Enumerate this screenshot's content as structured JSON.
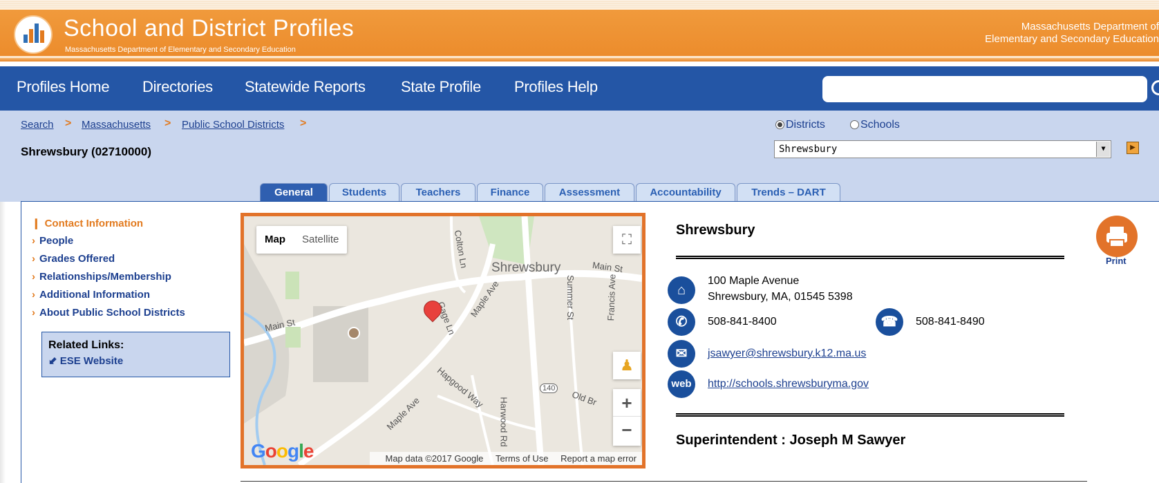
{
  "header": {
    "title": "School and District Profiles",
    "subtitle": "Massachusetts Department of Elementary and Secondary Education",
    "org_line1": "Massachusetts Department of",
    "org_line2": "Elementary and Secondary Education"
  },
  "nav": {
    "items": [
      "Profiles Home",
      "Directories",
      "Statewide Reports",
      "State Profile",
      "Profiles Help"
    ],
    "search_value": ""
  },
  "breadcrumb": {
    "items": [
      "Search",
      "Massachusetts",
      "Public School Districts"
    ],
    "separator": ">"
  },
  "entity_title": "Shrewsbury (02710000)",
  "selector": {
    "options": [
      "Districts",
      "Schools"
    ],
    "selected_option": "Districts",
    "select_value": "Shrewsbury"
  },
  "tabs": [
    "General",
    "Students",
    "Teachers",
    "Finance",
    "Assessment",
    "Accountability",
    "Trends – DART"
  ],
  "active_tab": "General",
  "sidebar": {
    "links": [
      "Contact Information",
      "People",
      "Grades Offered",
      "Relationships/Membership",
      "Additional Information",
      "About Public School Districts"
    ],
    "current": "Contact Information",
    "related_title": "Related Links:",
    "related_link": "ESE Website"
  },
  "map": {
    "toggle": [
      "Map",
      "Satellite"
    ],
    "selected": "Map",
    "place_label": "Shrewsbury",
    "street_labels": [
      "Main St",
      "Main St",
      "Maple Ave",
      "Maple Ave",
      "Gage Ln",
      "Colton Ln",
      "Hapgood Way",
      "Summer St",
      "Francis Ave",
      "Old Br",
      "Harwood Rd",
      "140"
    ],
    "attribution": [
      "Map data ©2017 Google",
      "Terms of Use",
      "Report a map error"
    ],
    "logo": "Google"
  },
  "contact": {
    "name": "Shrewsbury",
    "address_line1": "100 Maple Avenue",
    "address_line2": "Shrewsbury, MA, 01545 5398",
    "phone": "508-841-8400",
    "fax": "508-841-8490",
    "email": "jsawyer@shrewsbury.k12.ma.us",
    "website": "http://schools.shrewsburyma.gov",
    "superintendent": "Superintendent : Joseph M Sawyer",
    "web_icon_text": "web",
    "print_label": "Print"
  },
  "colors": {
    "banner_orange": "#ec8c2c",
    "nav_blue": "#2456a6",
    "crumb_bg": "#c9d6ee",
    "accent_orange": "#e27a1e",
    "link_blue": "#1c3f8f"
  },
  "icons": [
    "logo-icon",
    "search-icon",
    "home-icon",
    "phone-icon",
    "fax-icon",
    "email-icon",
    "web-icon",
    "print-icon",
    "map-pin-icon",
    "fullscreen-icon",
    "pegman-icon",
    "zoom-in-icon",
    "zoom-out-icon"
  ]
}
